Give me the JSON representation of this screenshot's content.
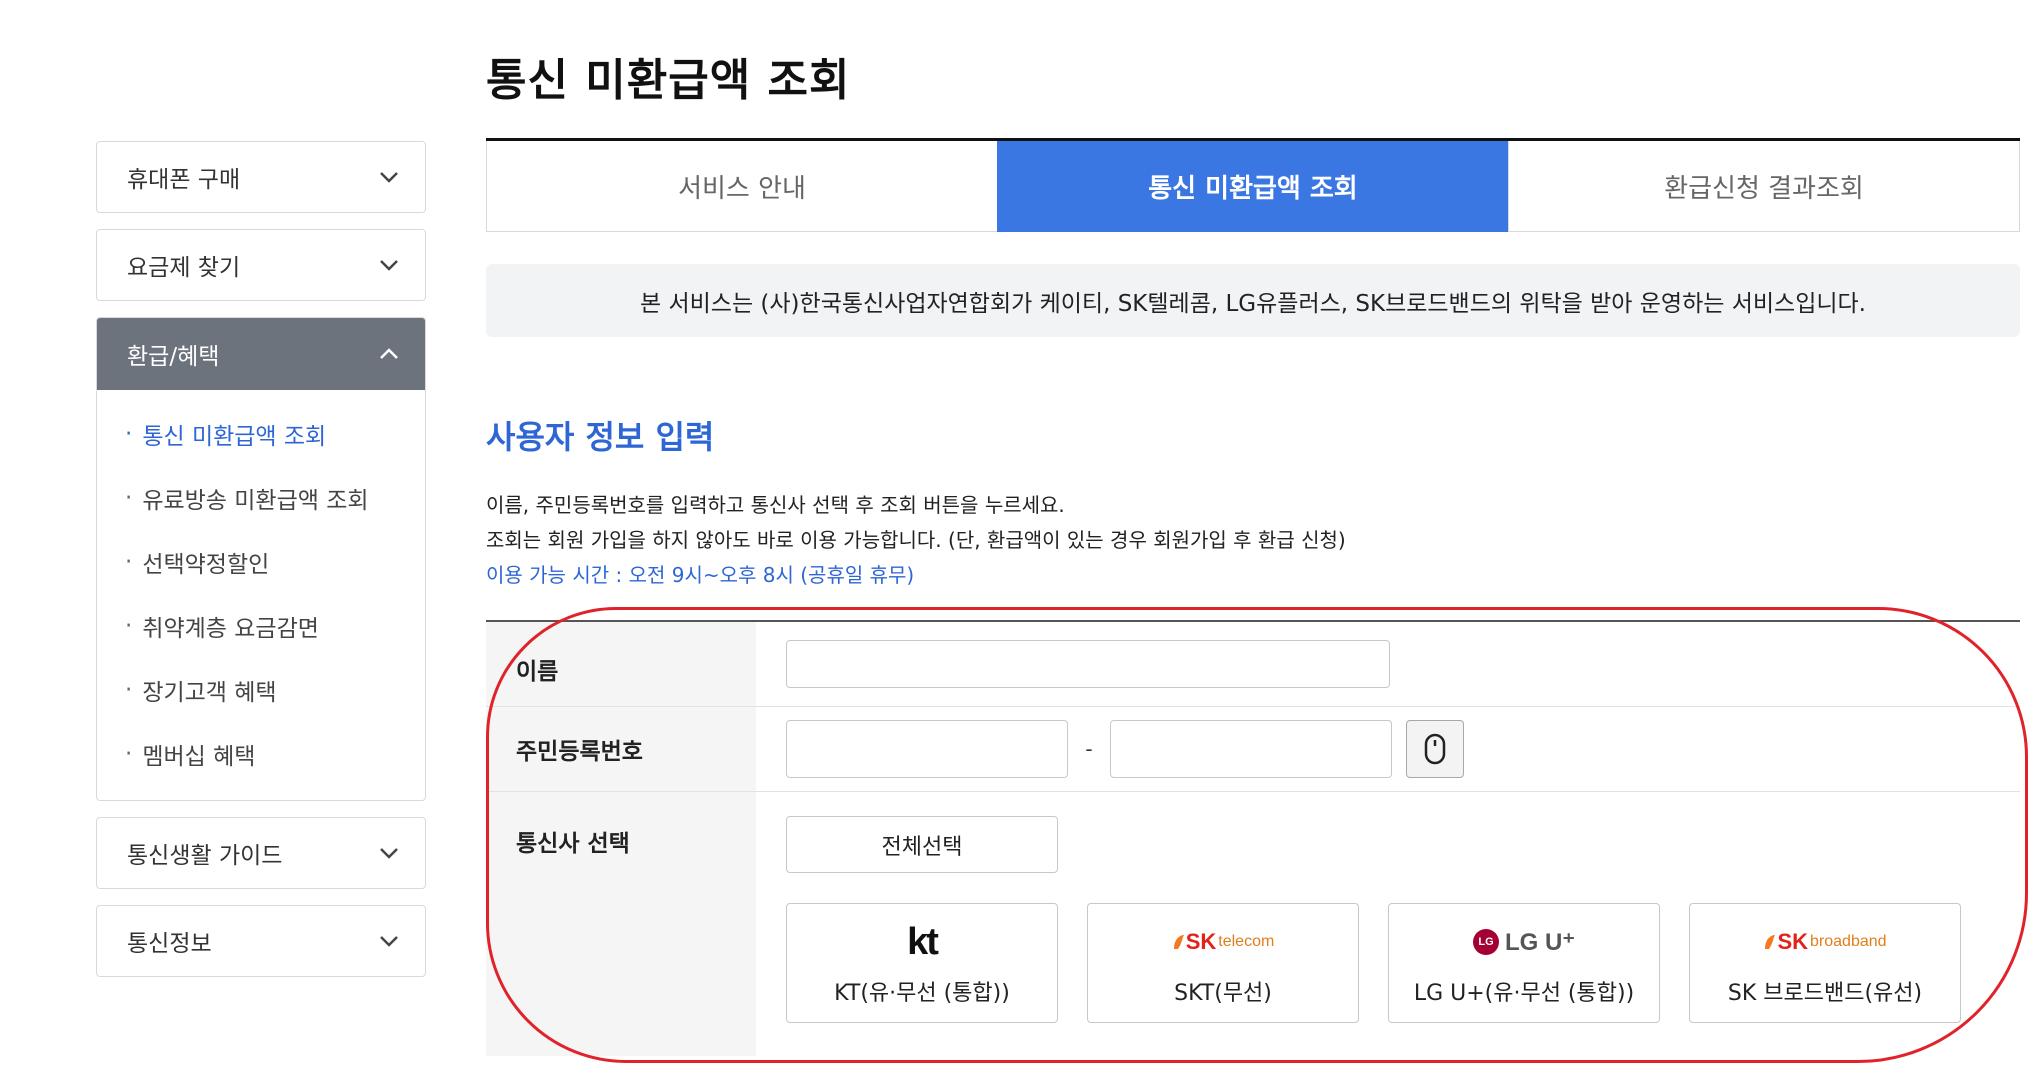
{
  "sidebar": {
    "items_top": [
      {
        "label": "휴대폰 구매"
      },
      {
        "label": "요금제 찾기"
      }
    ],
    "open_menu": {
      "label": "환급/혜택",
      "subitems": [
        {
          "label": "통신 미환급액 조회",
          "active": true
        },
        {
          "label": "유료방송 미환급액 조회"
        },
        {
          "label": "선택약정할인"
        },
        {
          "label": "취약계층 요금감면"
        },
        {
          "label": "장기고객 혜택"
        },
        {
          "label": "멤버십 혜택"
        }
      ]
    },
    "items_bottom": [
      {
        "label": "통신생활 가이드"
      },
      {
        "label": "통신정보"
      }
    ],
    "bullet": "·"
  },
  "page": {
    "title": "통신 미환급액 조회",
    "tabs": [
      {
        "label": "서비스 안내"
      },
      {
        "label": "통신 미환급액 조회",
        "active": true
      },
      {
        "label": "환급신청 결과조회"
      }
    ],
    "notice": "본 서비스는 (사)한국통신사업자연합회가 케이티, SK텔레콤, LG유플러스, SK브로드밴드의 위탁을 받아 운영하는 서비스입니다.",
    "section_title": "사용자 정보 입력",
    "desc_line1": "이름, 주민등록번호를 입력하고 통신사 선택 후 조회 버튼을 누르세요.",
    "desc_line2": "조회는 회원 가입을 하지 않아도 바로 이용 가능합니다. (단, 환급액이 있는 경우 회원가입 후 환급 신청)",
    "desc_hours": "이용 가능 시간 : 오전 9시~오후 8시 (공휴일 휴무)"
  },
  "form": {
    "name_label": "이름",
    "name_value": "",
    "rrn_label": "주민등록번호",
    "rrn_front_value": "",
    "rrn_back_value": "",
    "rrn_separator": "-",
    "carrier_label": "통신사 선택",
    "select_all_label": "전체선택",
    "carriers": [
      {
        "logo_text": "kt",
        "name": "KT(유·무선 (통합))"
      },
      {
        "logo_text": "SK",
        "logo_sub": "telecom",
        "name": "SKT(무선)"
      },
      {
        "logo_text": "LG U⁺",
        "logo_mark": "LG",
        "name": "LG U+(유·무선 (통합))"
      },
      {
        "logo_text": "SK",
        "logo_sub": "broadband",
        "name": "SK 브로드밴드(유선)"
      }
    ]
  },
  "colors": {
    "accent": "#3b77e3",
    "active_text": "#2f66d6",
    "highlight_ring": "#e0232a",
    "sidebar_open_bg": "#6c737c"
  }
}
